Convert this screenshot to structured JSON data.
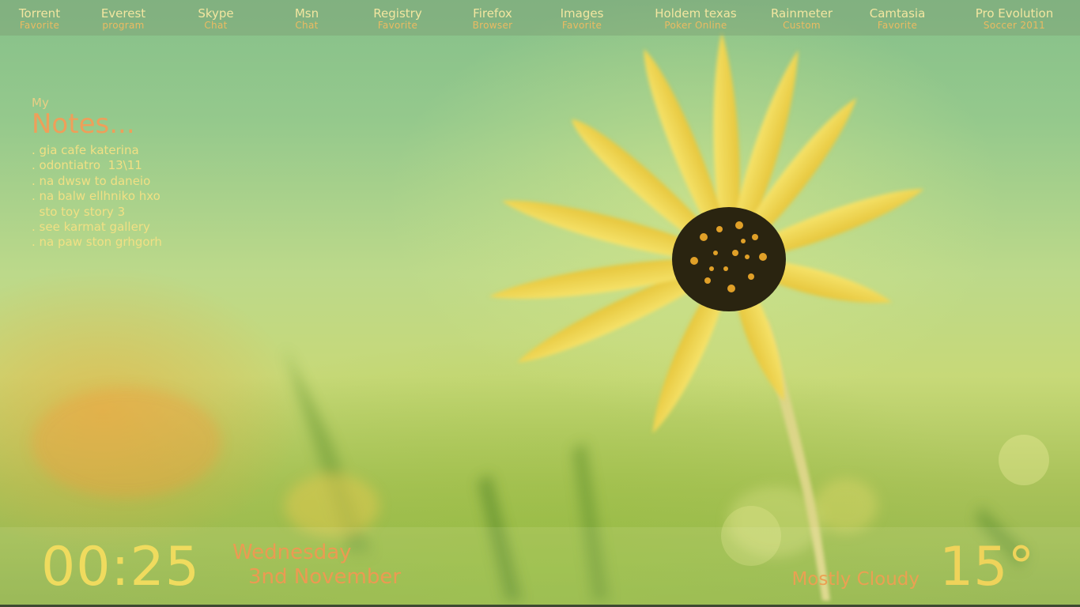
{
  "launcher": [
    {
      "name": "Torrent",
      "sub": "Favorite"
    },
    {
      "name": "Everest",
      "sub": "program"
    },
    {
      "name": "Skype",
      "sub": "Chat"
    },
    {
      "name": "Msn",
      "sub": "Chat"
    },
    {
      "name": "Registry",
      "sub": "Favorite"
    },
    {
      "name": "Firefox",
      "sub": "Browser"
    },
    {
      "name": "Images",
      "sub": "Favorite"
    },
    {
      "name": "Holdem texas",
      "sub": "Poker Online"
    },
    {
      "name": "Rainmeter",
      "sub": "Custom"
    },
    {
      "name": "Camtasia",
      "sub": "Favorite"
    },
    {
      "name": "Pro Evolution",
      "sub": "Soccer 2011"
    }
  ],
  "notes": {
    "label": "My",
    "title": "Notes...",
    "items": [
      ". gia cafe katerina",
      ". odontiatro  13\\11",
      ". na dwsw to daneio",
      ". na balw ellhniko hxo",
      "  sto toy story 3",
      ". see karmat gallery",
      ". na paw ston grhgorh"
    ]
  },
  "clock": {
    "time": "00:25",
    "day": "Wednesday",
    "date": "3nd November"
  },
  "weather": {
    "condition": "Mostly Cloudy",
    "temperature": "15°"
  },
  "colors": {
    "accent_yellow": "#efdb5e",
    "accent_orange": "#ec9a52"
  }
}
